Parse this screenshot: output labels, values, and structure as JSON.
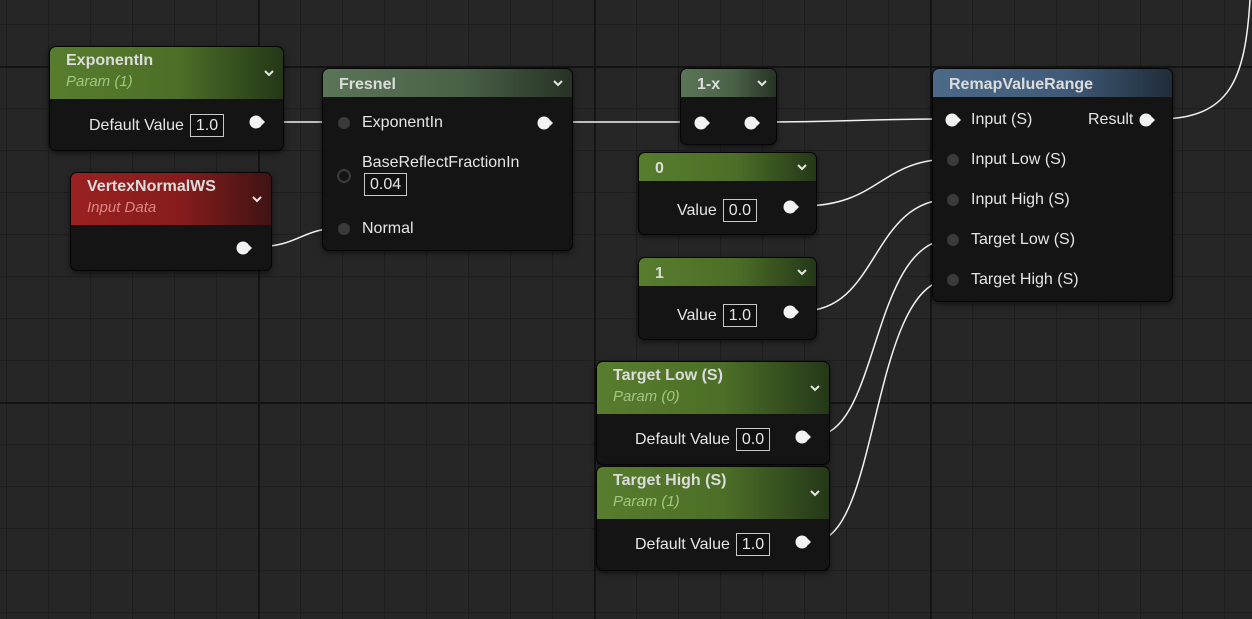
{
  "graph": {
    "exponent_param": {
      "title": "ExponentIn",
      "subtitle": "Param (1)",
      "value_label": "Default Value",
      "value": "1.0"
    },
    "vertex_normal": {
      "title": "VertexNormalWS",
      "subtitle": "Input Data"
    },
    "fresnel": {
      "title": "Fresnel",
      "pins": [
        "ExponentIn",
        "BaseReflectFractionIn",
        "Normal"
      ],
      "base_reflect_value": "0.04"
    },
    "one_minus": {
      "title": "1-x"
    },
    "const_zero": {
      "title": "0",
      "value_label": "Value",
      "value": "0.0"
    },
    "const_one": {
      "title": "1",
      "value_label": "Value",
      "value": "1.0"
    },
    "target_low": {
      "title": "Target Low (S)",
      "subtitle": "Param (0)",
      "value_label": "Default Value",
      "value": "0.0"
    },
    "target_high": {
      "title": "Target High (S)",
      "subtitle": "Param (1)",
      "value_label": "Default Value",
      "value": "1.0"
    },
    "remap": {
      "title": "RemapValueRange",
      "inputs": [
        "Input (S)",
        "Input Low (S)",
        "Input High (S)",
        "Target Low (S)",
        "Target High (S)"
      ],
      "output": "Result"
    }
  },
  "colors": {
    "param_header": "#587d2e",
    "input_data_header": "#9a2121",
    "function_header": "#5b7558",
    "remap_header": "#4c6a88",
    "wire": "#ffffff",
    "canvas": "#262626"
  },
  "icons": [
    "chevron-down-icon",
    "exec-pin-icon"
  ]
}
